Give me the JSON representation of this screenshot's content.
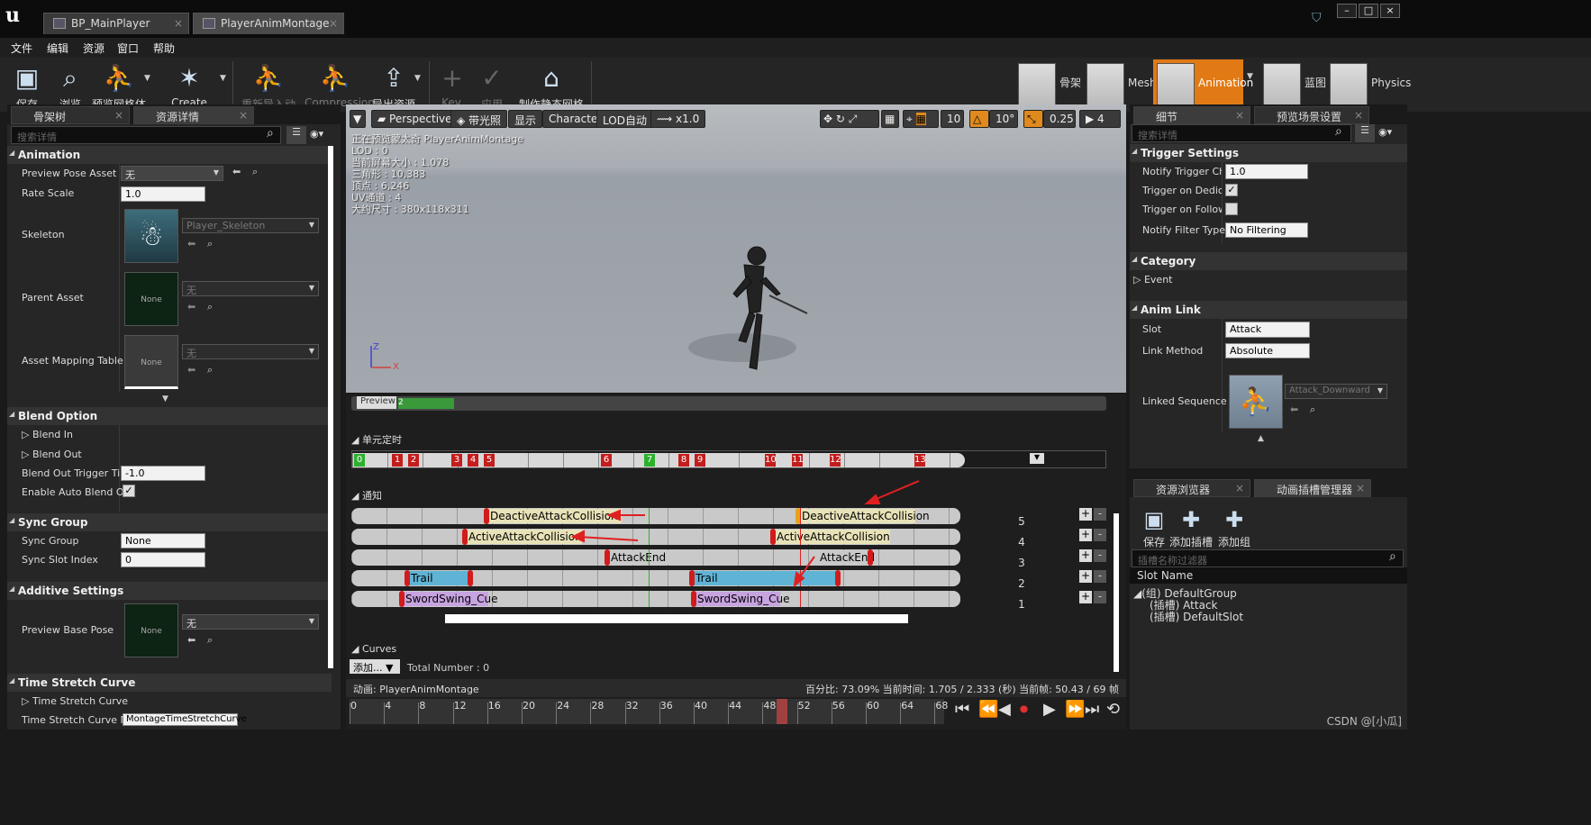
{
  "titlebar": {
    "tabs": [
      "BP_MainPlayer",
      "PlayerAnimMontage"
    ]
  },
  "menu": [
    "文件",
    "编辑",
    "资源",
    "窗口",
    "帮助"
  ],
  "toolbar": {
    "buttons": [
      "保存",
      "浏览",
      "预览网格体",
      "Create Asset",
      "重新导入动画",
      "Compression",
      "导出资源",
      "Key",
      "应用",
      "制作静态网格体"
    ],
    "modes": [
      "骨架",
      "Mesh",
      "Animation",
      "蓝图",
      "Physics"
    ]
  },
  "left": {
    "tabs": [
      "骨架树",
      "资源详情"
    ],
    "search_placeholder": "搜索详情",
    "animation": {
      "title": "Animation",
      "preview_pose_label": "Preview Pose Asset",
      "preview_pose_value": "无",
      "rate_scale_label": "Rate Scale",
      "rate_scale_value": "1.0",
      "skeleton_label": "Skeleton",
      "skeleton_value": "Player_Skeleton",
      "parent_label": "Parent Asset",
      "parent_value": "无",
      "none": "None",
      "mapping_label": "Asset Mapping Table",
      "mapping_value": "无"
    },
    "blend": {
      "title": "Blend Option",
      "blend_in": "Blend In",
      "blend_out": "Blend Out",
      "trigger_label": "Blend Out Trigger Time",
      "trigger_value": "-1.0",
      "auto_label": "Enable Auto Blend Out"
    },
    "sync": {
      "title": "Sync Group",
      "group_label": "Sync Group",
      "group_value": "None",
      "slot_label": "Sync Slot Index",
      "slot_value": "0"
    },
    "additive": {
      "title": "Additive Settings",
      "base_label": "Preview Base Pose",
      "base_value": "无"
    },
    "timestretch": {
      "title": "Time Stretch Curve",
      "curve_label": "Time Stretch Curve",
      "name_label": "Time Stretch Curve Nam",
      "name_value": "MontageTimeStretchCurve"
    }
  },
  "viewport": {
    "buttons": [
      "Perspective",
      "带光照",
      "显示",
      "Character",
      "LOD自动",
      "x1.0"
    ],
    "right_values": [
      "10",
      "10°",
      "0.25",
      "4"
    ],
    "stats": [
      "正在预览蒙太奇 PlayerAnimMontage",
      "LOD : 0",
      "当前屏幕大小 : 1.078",
      "三角形 : 10,383",
      "顶点 : 6,246",
      "UV通道 : 4",
      "大约尺寸 : 380x118x311"
    ]
  },
  "timeline": {
    "preview_label": "Preview",
    "preview_num": "2",
    "sections_title": "单元定时",
    "sections": [
      {
        "n": "0",
        "c": "#2db12d"
      },
      {
        "n": "1",
        "c": "#c41d1d"
      },
      {
        "n": "2",
        "c": "#c41d1d"
      },
      {
        "n": "3",
        "c": "#c41d1d"
      },
      {
        "n": "4",
        "c": "#c41d1d"
      },
      {
        "n": "5",
        "c": "#c41d1d"
      },
      {
        "n": "6",
        "c": "#c41d1d"
      },
      {
        "n": "7",
        "c": "#2db12d"
      },
      {
        "n": "8",
        "c": "#c41d1d"
      },
      {
        "n": "9",
        "c": "#c41d1d"
      },
      {
        "n": "10",
        "c": "#c41d1d"
      },
      {
        "n": "11",
        "c": "#c41d1d"
      },
      {
        "n": "12",
        "c": "#c41d1d"
      },
      {
        "n": "13",
        "c": "#c41d1d"
      }
    ],
    "notify_title": "通知",
    "notifies": [
      "DeactiveAttackCollision",
      "DeactiveAttackCollision",
      "ActiveAttackCollision",
      "ActiveAttackCollision",
      "AttackEnd",
      "AttackEnd",
      "Trail",
      "Trail",
      "SwordSwing_Cue",
      "SwordSwing_Cue"
    ],
    "row_numbers": [
      "5",
      "4",
      "3",
      "2",
      "1"
    ],
    "curves_title": "Curves",
    "add_label": "添加...",
    "total_label": "Total Number : 0",
    "anim_label": "动画: PlayerAnimMontage",
    "status": "百分比: 73.09% 当前时间: 1.705 / 2.333 (秒) 当前帧: 50.43 / 69 帧",
    "frame_ticks": [
      "0",
      "4",
      "8",
      "12",
      "16",
      "20",
      "24",
      "28",
      "32",
      "36",
      "40",
      "44",
      "48",
      "52",
      "56",
      "60",
      "64",
      "68"
    ]
  },
  "right": {
    "tabs": [
      "细节",
      "预览场景设置"
    ],
    "search_placeholder": "搜索详情",
    "trigger": {
      "title": "Trigger Settings",
      "chance_label": "Notify Trigger Chan",
      "chance_value": "1.0",
      "dedicated_label": "Trigger on Dedicate",
      "follower_label": "Trigger on Follower",
      "filter_label": "Notify Filter Type",
      "filter_value": "No Filtering"
    },
    "category": {
      "title": "Category",
      "event": "Event"
    },
    "animlink": {
      "title": "Anim Link",
      "slot_label": "Slot",
      "slot_value": "Attack",
      "method_label": "Link Method",
      "method_value": "Absolute",
      "linked_label": "Linked Sequence",
      "linked_value": "Attack_Downward"
    }
  },
  "bottomright": {
    "tabs": [
      "资源浏览器",
      "动画插槽管理器"
    ],
    "buttons": [
      "保存",
      "添加插槽",
      "添加组"
    ],
    "filter_placeholder": "插槽名称过滤器",
    "header": "Slot Name",
    "tree": [
      "(组) DefaultGroup",
      "(插槽) Attack",
      "(插槽) DefaultSlot"
    ]
  },
  "watermark": "CSDN @[小瓜]"
}
